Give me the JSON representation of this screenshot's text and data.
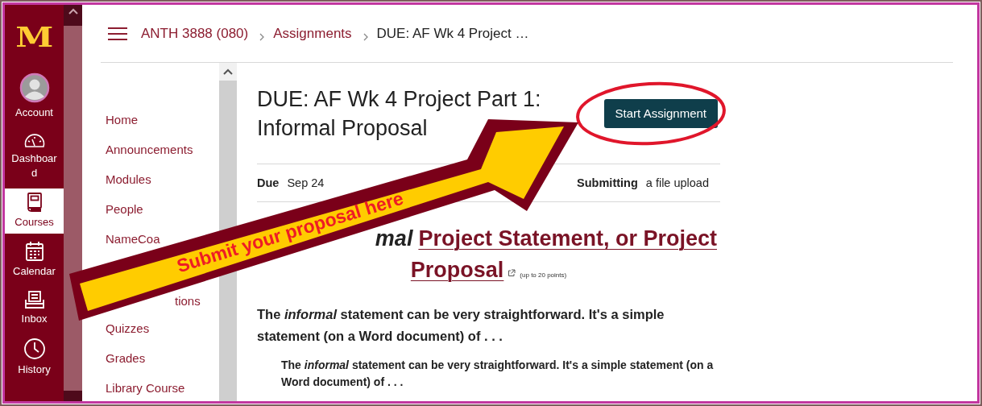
{
  "global_nav": {
    "logo": "M",
    "items": [
      {
        "label": "Account",
        "selected": false
      },
      {
        "label": "Dashboard",
        "selected": false
      },
      {
        "label": "Courses",
        "selected": true
      },
      {
        "label": "Calendar",
        "selected": false
      },
      {
        "label": "Inbox",
        "selected": false
      },
      {
        "label": "History",
        "selected": false
      }
    ]
  },
  "breadcrumbs": [
    {
      "label": "ANTH 3888 (080)",
      "current": false
    },
    {
      "label": "Assignments",
      "current": false
    },
    {
      "label": "DUE: AF Wk 4 Project …",
      "current": true
    }
  ],
  "course_nav": {
    "items": [
      {
        "label": "Home",
        "selected": false,
        "kind": "link"
      },
      {
        "label": "Announcements",
        "selected": false,
        "kind": "link"
      },
      {
        "label": "Modules",
        "selected": false,
        "kind": "link"
      },
      {
        "label": "People",
        "selected": false,
        "kind": "link"
      },
      {
        "label": "NameCoa",
        "selected": false,
        "kind": "link"
      },
      {
        "label": "tions",
        "selected": false,
        "kind": "covered"
      },
      {
        "label": "Quizzes",
        "selected": false,
        "kind": "link"
      },
      {
        "label": "Grades",
        "selected": false,
        "kind": "link"
      },
      {
        "label": "Library Course",
        "selected": false,
        "kind": "link"
      }
    ]
  },
  "assignment": {
    "title": "DUE: AF Wk 4 Project Part 1: Informal Proposal",
    "start_button": "Start Assignment",
    "details": [
      {
        "label": "Due",
        "value": "Sep 24"
      },
      {
        "label": "Submitting",
        "value": "a file upload"
      }
    ],
    "heading": {
      "lead": "mal",
      "link_lines": [
        "Project Statement, or Project",
        "Proposal"
      ],
      "note": "(up to 20 points)"
    },
    "paragraphs": [
      {
        "kind": "lead",
        "text": "The *informal* statement can be very straightforward. It's a simple statement (on a Word document) of . . ."
      },
      {
        "kind": "quote",
        "text": "The *informal* statement can be very straightforward. It's a simple statement (on a Word document) of . . ."
      }
    ]
  },
  "callout": {
    "label": "Submit your proposal here"
  }
}
